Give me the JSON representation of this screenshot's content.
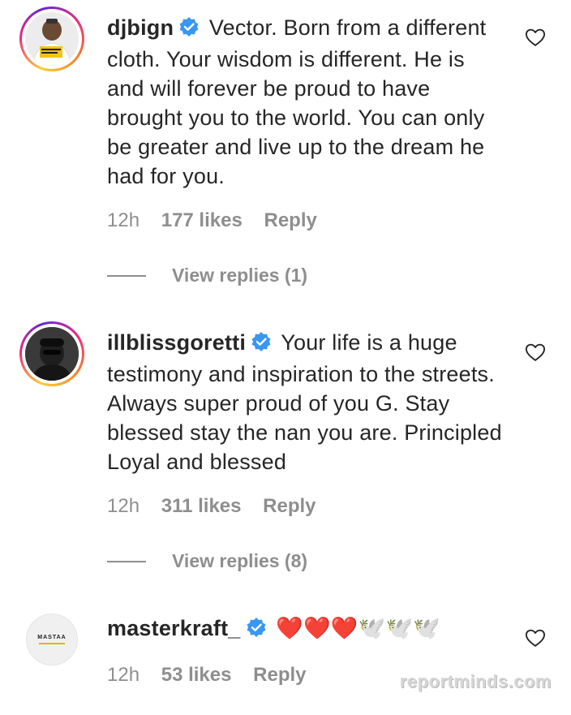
{
  "comments": [
    {
      "username": "djbign",
      "text": "Vector. Born from a different cloth. Your wisdom is different. He is and will forever be proud to have brought you to the world. You can only be greater and live up to the dream he had for you.",
      "time": "12h",
      "likes": "177 likes",
      "reply_label": "Reply",
      "view_replies": "View replies (1)"
    },
    {
      "username": "illblissgoretti",
      "text": "Your life is a huge testimony and inspiration to the streets. Always super proud of you G. Stay blessed stay the nan you are. Principled Loyal and blessed",
      "time": "12h",
      "likes": "311 likes",
      "reply_label": "Reply",
      "view_replies": "View replies (8)"
    },
    {
      "username": "masterkraft_",
      "text": "❤️❤️❤️🕊️🕊️🕊️",
      "time": "12h",
      "likes": "53 likes",
      "reply_label": "Reply"
    }
  ],
  "avatar3_text": "MASTAA",
  "watermark": "reportminds.com",
  "colors": {
    "verified_blue": "#3897f0",
    "meta_gray": "#8e8e8e",
    "text": "#262626"
  },
  "icons": [
    "verified-badge-icon",
    "heart-outline-icon"
  ]
}
